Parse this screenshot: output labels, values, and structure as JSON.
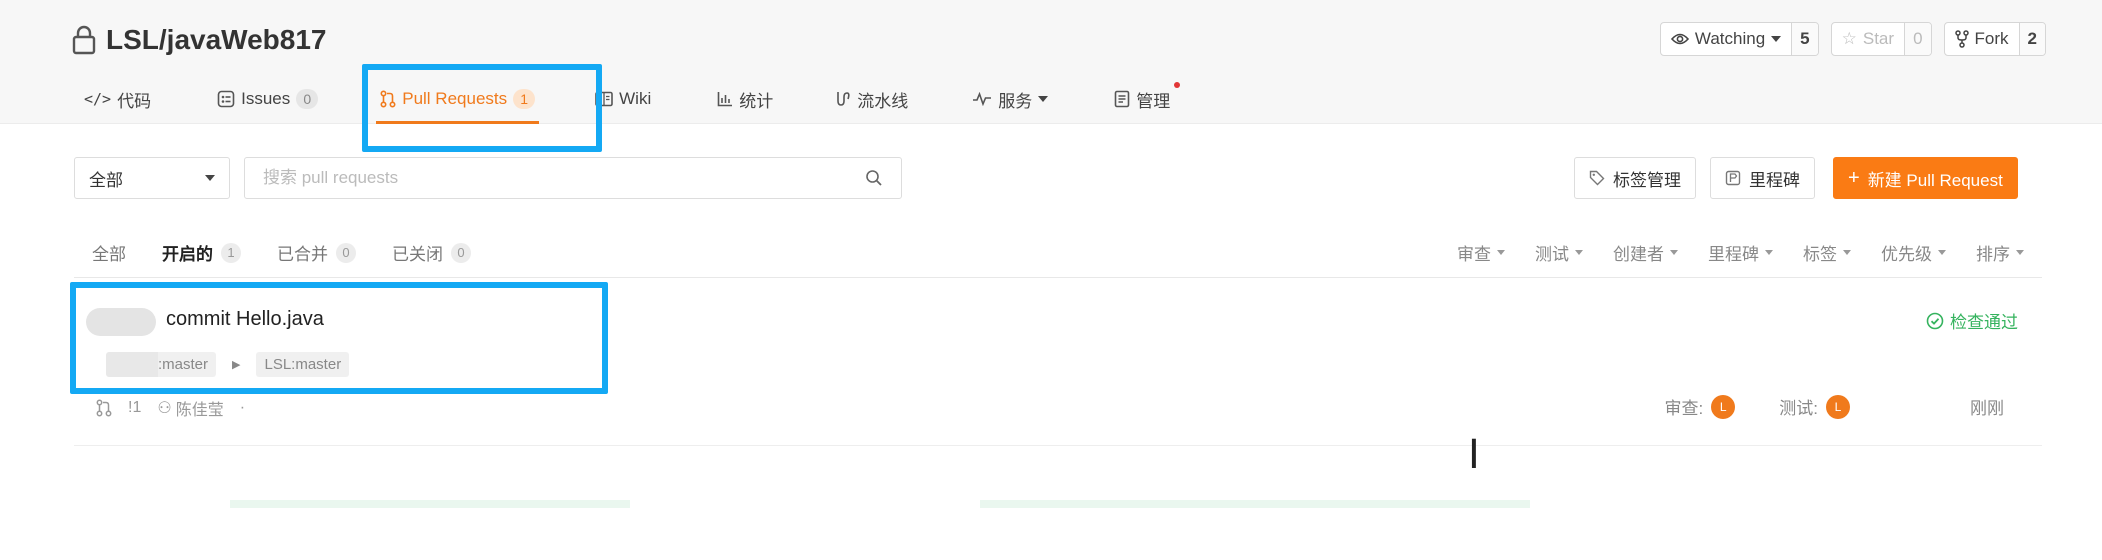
{
  "repo": {
    "name": "LSL/javaWeb817",
    "watching": {
      "label": "Watching",
      "count": "5"
    },
    "star": {
      "label": "Star",
      "count": "0"
    },
    "fork": {
      "label": "Fork",
      "count": "2"
    }
  },
  "tabs": [
    {
      "label": "代码",
      "icon": "code-icon"
    },
    {
      "label": "Issues",
      "badge": "0",
      "icon": "issues-icon"
    },
    {
      "label": "Pull Requests",
      "badge": "1",
      "icon": "pull-request-icon"
    },
    {
      "label": "Wiki",
      "icon": "wiki-icon"
    },
    {
      "label": "统计",
      "icon": "chart-icon"
    },
    {
      "label": "流水线",
      "icon": "pipeline-icon"
    },
    {
      "label": "服务",
      "icon": "pulse-icon"
    },
    {
      "label": "管理",
      "icon": "manage-icon"
    }
  ],
  "toolbar": {
    "scope_select": "全部",
    "search_placeholder": "搜索 pull requests",
    "labels_button": "标签管理",
    "milestones_button": "里程碑",
    "new_pr_button": "新建 Pull Request"
  },
  "state_tabs": [
    {
      "label": "全部"
    },
    {
      "label": "开启的",
      "count": "1"
    },
    {
      "label": "已合并",
      "count": "0"
    },
    {
      "label": "已关闭",
      "count": "0"
    }
  ],
  "filter_dropdowns": [
    "审查",
    "测试",
    "创建者",
    "里程碑",
    "标签",
    "优先级",
    "排序"
  ],
  "pull_requests": [
    {
      "title": "commit Hello.java",
      "source_branch": ":master",
      "target_branch": "LSL:master",
      "status": "检查通过",
      "comments": "!1",
      "author": "陈佳莹",
      "separator": "·",
      "review_label": "审查:",
      "reviewer_initial": "L",
      "test_label": "测试:",
      "tester_initial": "L",
      "time": "刚刚"
    }
  ],
  "colors": {
    "accent": "#f07a1c",
    "primary_button": "#fa7b14",
    "highlight_box": "#14a9f4",
    "success": "#35b35e"
  }
}
